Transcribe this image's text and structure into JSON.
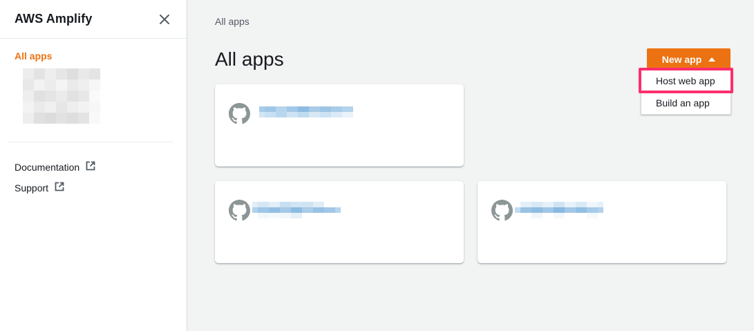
{
  "sidebar": {
    "title": "AWS Amplify",
    "active_item": "All apps",
    "links": [
      {
        "label": "Documentation",
        "icon": "external-link-icon"
      },
      {
        "label": "Support",
        "icon": "external-link-icon"
      }
    ]
  },
  "breadcrumb": "All apps",
  "page_title": "All apps",
  "new_app_button": "New app",
  "dropdown": {
    "items": [
      "Host web app",
      "Build an app"
    ],
    "highlighted": "Host web app"
  },
  "cards": [
    {
      "icon": "github-icon"
    },
    {
      "icon": "github-icon"
    },
    {
      "icon": "github-icon"
    }
  ],
  "colors": {
    "accent": "#ec7211",
    "highlight_box": "#ff2e6c",
    "background": "#f2f3f3",
    "link_blur": "#8ab9e0"
  }
}
